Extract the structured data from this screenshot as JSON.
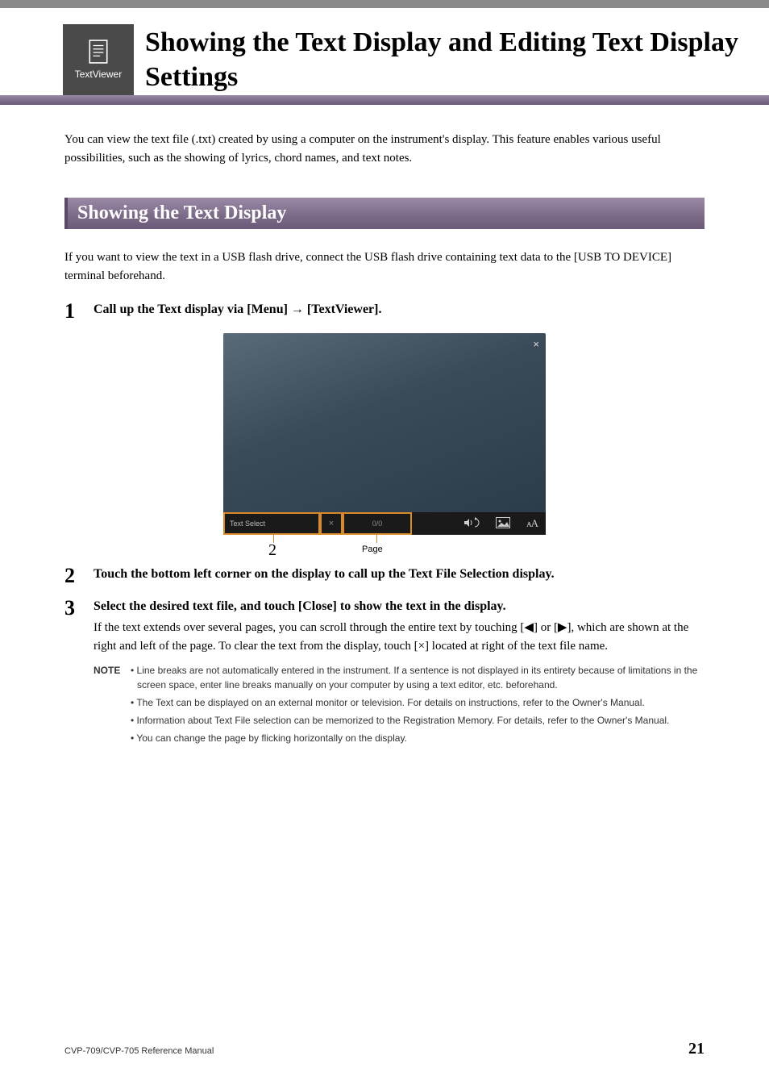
{
  "badge": {
    "label": "TextViewer"
  },
  "title": "Showing the Text Display and Editing Text Display Settings",
  "intro": "You can view the text file (.txt) created by using a computer on the instrument's display. This feature enables various useful possibilities, such as the showing of lyrics, chord names, and text notes.",
  "section_heading": "Showing the Text Display",
  "section_intro": "If you want to view the text in a USB flash drive, connect the USB flash drive containing text data to the [USB TO DEVICE] terminal beforehand.",
  "steps": {
    "s1": {
      "num": "1",
      "head": "Call up the Text display via [Menu] → [TextViewer]."
    },
    "s2": {
      "num": "2",
      "head": "Touch the bottom left corner on the display to call up the Text File Selection display."
    },
    "s3": {
      "num": "3",
      "head": "Select the desired text file, and touch [Close] to show the text in the display.",
      "desc": "If the text extends over several pages, you can scroll through the entire text by touching [◀] or [▶], which are shown at the right and left of the page. To clear the text from the display, touch [×] located at right of the text file name."
    }
  },
  "screenshot": {
    "text_select": "Text Select",
    "close_small": "×",
    "page_ind": "0/0",
    "close_x": "×",
    "ann_num": "2",
    "ann_page": "Page"
  },
  "note": {
    "label": "NOTE",
    "items": [
      "Line breaks are not automatically entered in the instrument. If a sentence is not displayed in its entirety because of limitations in the screen space, enter line breaks manually on your computer by using a text editor, etc. beforehand.",
      "The Text can be displayed on an external monitor or television. For details on instructions, refer to the Owner's Manual.",
      "Information about Text File selection can be memorized to the Registration Memory. For details, refer to the Owner's Manual.",
      "You can change the page by flicking horizontally on the display."
    ]
  },
  "footer": {
    "left": "CVP-709/CVP-705 Reference Manual",
    "page": "21"
  }
}
